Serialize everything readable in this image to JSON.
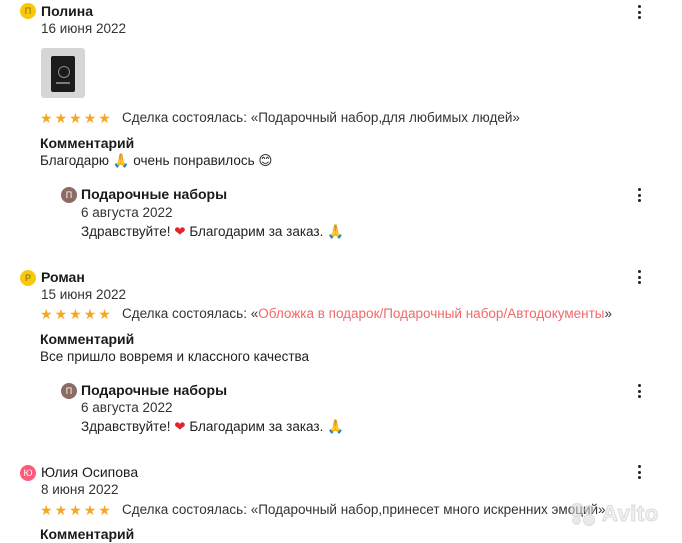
{
  "reviews": [
    {
      "avatar_letter": "П",
      "author": "Полина",
      "date": "16 июня 2022",
      "rating": 5,
      "deal_prefix": "Сделка состоялась: «",
      "deal_item": "Подарочный набор,для любимых людей",
      "deal_suffix": "»",
      "comment_label": "Комментарий",
      "comment_text": "Благодарю",
      "comment_emoji_1": "🙏",
      "comment_text_2": "очень понравилось",
      "comment_emoji_2": "😊",
      "reply": {
        "avatar_letter": "П",
        "author": "Подарочные наборы",
        "date": "6 августа 2022",
        "text_1": "Здравствуйте!",
        "heart": "❤",
        "text_2": "Благодарим за заказ.",
        "emoji": "🙏"
      }
    },
    {
      "avatar_letter": "Р",
      "author": "Роман",
      "date": "15 июня 2022",
      "rating": 5,
      "deal_prefix": "Сделка состоялась: «",
      "deal_item": "Обложка в подарок/Подарочный набор/Автодокументы",
      "deal_suffix": "»",
      "comment_label": "Комментарий",
      "comment_text": "Все пришло вовремя и классного качества",
      "reply": {
        "avatar_letter": "П",
        "author": "Подарочные наборы",
        "date": "6 августа 2022",
        "text_1": "Здравствуйте!",
        "heart": "❤",
        "text_2": "Благодарим за заказ.",
        "emoji": "🙏"
      }
    },
    {
      "avatar_letter": "Ю",
      "author": "Юлия Осипова",
      "date": "8 июня 2022",
      "rating": 5,
      "deal_prefix": "Сделка состоялась: «",
      "deal_item": "Подарочный набор,принесет много искренних эмоций",
      "deal_suffix": "»",
      "comment_label": "Комментарий"
    }
  ],
  "star_glyph": "★",
  "watermark": "Avito",
  "colors": {
    "star": "#f5a623",
    "link": "#f26868",
    "avatar_yellow": "#f6c90e",
    "avatar_pink": "#ff5a7a",
    "avatar_brown": "#8b6b62",
    "heart": "#e0242b"
  }
}
